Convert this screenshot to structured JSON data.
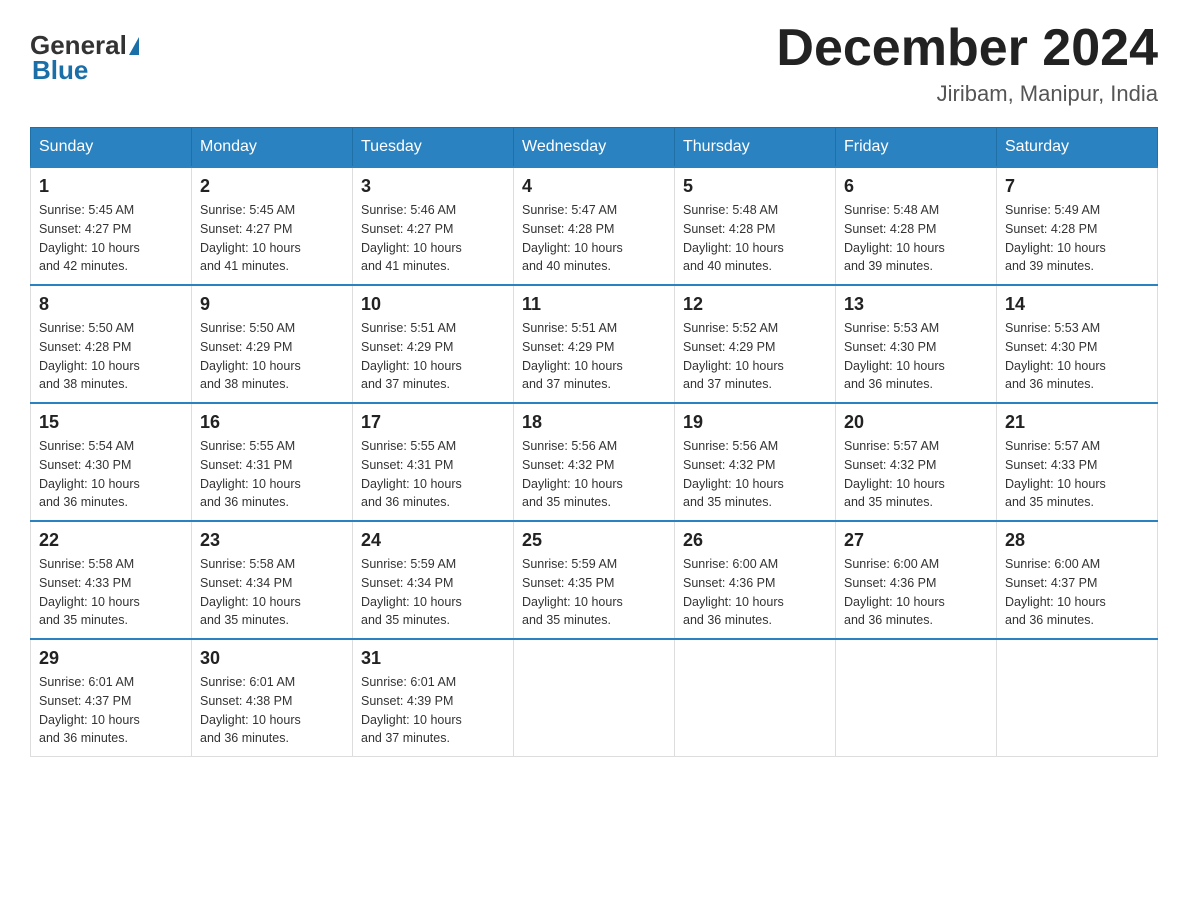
{
  "header": {
    "logo_general": "General",
    "logo_blue": "Blue",
    "main_title": "December 2024",
    "subtitle": "Jiribam, Manipur, India"
  },
  "days_of_week": [
    "Sunday",
    "Monday",
    "Tuesday",
    "Wednesday",
    "Thursday",
    "Friday",
    "Saturday"
  ],
  "weeks": [
    [
      {
        "day": "1",
        "sunrise": "5:45 AM",
        "sunset": "4:27 PM",
        "daylight": "10 hours and 42 minutes."
      },
      {
        "day": "2",
        "sunrise": "5:45 AM",
        "sunset": "4:27 PM",
        "daylight": "10 hours and 41 minutes."
      },
      {
        "day": "3",
        "sunrise": "5:46 AM",
        "sunset": "4:27 PM",
        "daylight": "10 hours and 41 minutes."
      },
      {
        "day": "4",
        "sunrise": "5:47 AM",
        "sunset": "4:28 PM",
        "daylight": "10 hours and 40 minutes."
      },
      {
        "day": "5",
        "sunrise": "5:48 AM",
        "sunset": "4:28 PM",
        "daylight": "10 hours and 40 minutes."
      },
      {
        "day": "6",
        "sunrise": "5:48 AM",
        "sunset": "4:28 PM",
        "daylight": "10 hours and 39 minutes."
      },
      {
        "day": "7",
        "sunrise": "5:49 AM",
        "sunset": "4:28 PM",
        "daylight": "10 hours and 39 minutes."
      }
    ],
    [
      {
        "day": "8",
        "sunrise": "5:50 AM",
        "sunset": "4:28 PM",
        "daylight": "10 hours and 38 minutes."
      },
      {
        "day": "9",
        "sunrise": "5:50 AM",
        "sunset": "4:29 PM",
        "daylight": "10 hours and 38 minutes."
      },
      {
        "day": "10",
        "sunrise": "5:51 AM",
        "sunset": "4:29 PM",
        "daylight": "10 hours and 37 minutes."
      },
      {
        "day": "11",
        "sunrise": "5:51 AM",
        "sunset": "4:29 PM",
        "daylight": "10 hours and 37 minutes."
      },
      {
        "day": "12",
        "sunrise": "5:52 AM",
        "sunset": "4:29 PM",
        "daylight": "10 hours and 37 minutes."
      },
      {
        "day": "13",
        "sunrise": "5:53 AM",
        "sunset": "4:30 PM",
        "daylight": "10 hours and 36 minutes."
      },
      {
        "day": "14",
        "sunrise": "5:53 AM",
        "sunset": "4:30 PM",
        "daylight": "10 hours and 36 minutes."
      }
    ],
    [
      {
        "day": "15",
        "sunrise": "5:54 AM",
        "sunset": "4:30 PM",
        "daylight": "10 hours and 36 minutes."
      },
      {
        "day": "16",
        "sunrise": "5:55 AM",
        "sunset": "4:31 PM",
        "daylight": "10 hours and 36 minutes."
      },
      {
        "day": "17",
        "sunrise": "5:55 AM",
        "sunset": "4:31 PM",
        "daylight": "10 hours and 36 minutes."
      },
      {
        "day": "18",
        "sunrise": "5:56 AM",
        "sunset": "4:32 PM",
        "daylight": "10 hours and 35 minutes."
      },
      {
        "day": "19",
        "sunrise": "5:56 AM",
        "sunset": "4:32 PM",
        "daylight": "10 hours and 35 minutes."
      },
      {
        "day": "20",
        "sunrise": "5:57 AM",
        "sunset": "4:32 PM",
        "daylight": "10 hours and 35 minutes."
      },
      {
        "day": "21",
        "sunrise": "5:57 AM",
        "sunset": "4:33 PM",
        "daylight": "10 hours and 35 minutes."
      }
    ],
    [
      {
        "day": "22",
        "sunrise": "5:58 AM",
        "sunset": "4:33 PM",
        "daylight": "10 hours and 35 minutes."
      },
      {
        "day": "23",
        "sunrise": "5:58 AM",
        "sunset": "4:34 PM",
        "daylight": "10 hours and 35 minutes."
      },
      {
        "day": "24",
        "sunrise": "5:59 AM",
        "sunset": "4:34 PM",
        "daylight": "10 hours and 35 minutes."
      },
      {
        "day": "25",
        "sunrise": "5:59 AM",
        "sunset": "4:35 PM",
        "daylight": "10 hours and 35 minutes."
      },
      {
        "day": "26",
        "sunrise": "6:00 AM",
        "sunset": "4:36 PM",
        "daylight": "10 hours and 36 minutes."
      },
      {
        "day": "27",
        "sunrise": "6:00 AM",
        "sunset": "4:36 PM",
        "daylight": "10 hours and 36 minutes."
      },
      {
        "day": "28",
        "sunrise": "6:00 AM",
        "sunset": "4:37 PM",
        "daylight": "10 hours and 36 minutes."
      }
    ],
    [
      {
        "day": "29",
        "sunrise": "6:01 AM",
        "sunset": "4:37 PM",
        "daylight": "10 hours and 36 minutes."
      },
      {
        "day": "30",
        "sunrise": "6:01 AM",
        "sunset": "4:38 PM",
        "daylight": "10 hours and 36 minutes."
      },
      {
        "day": "31",
        "sunrise": "6:01 AM",
        "sunset": "4:39 PM",
        "daylight": "10 hours and 37 minutes."
      },
      null,
      null,
      null,
      null
    ]
  ],
  "labels": {
    "sunrise": "Sunrise:",
    "sunset": "Sunset:",
    "daylight": "Daylight:"
  }
}
